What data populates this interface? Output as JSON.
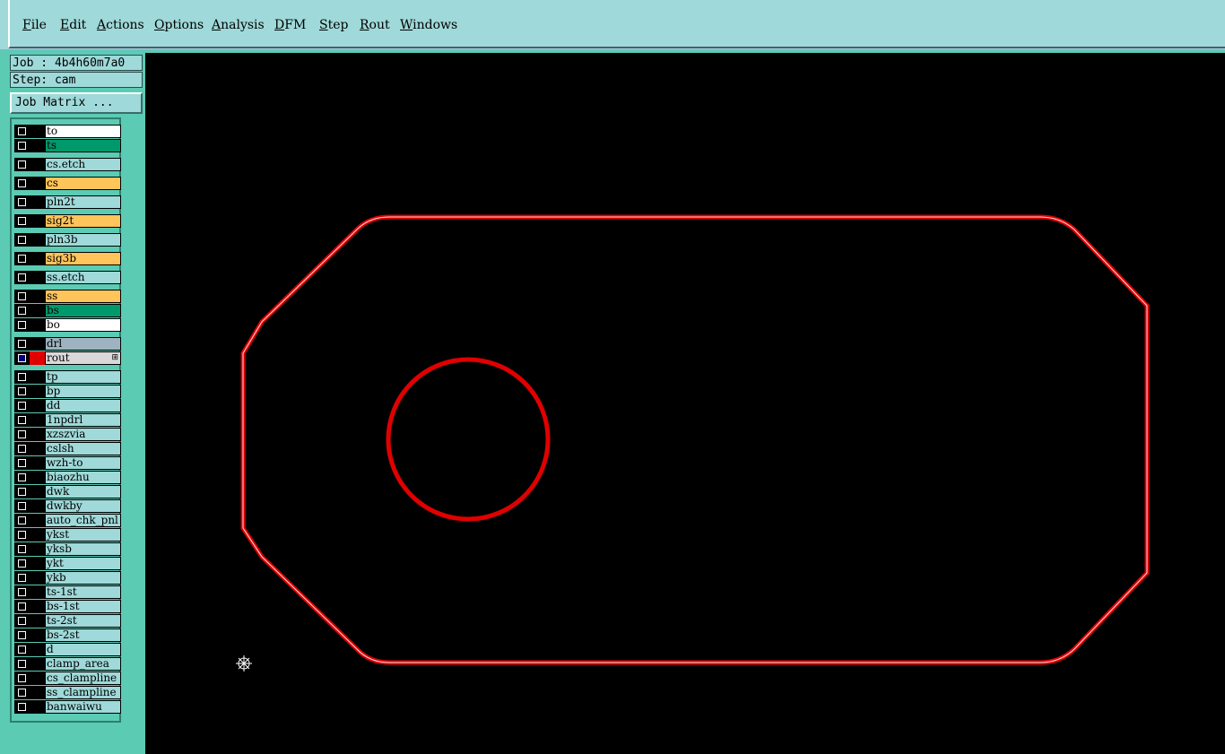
{
  "menu": [
    {
      "label": "File"
    },
    {
      "label": "Edit"
    },
    {
      "label": "Actions"
    },
    {
      "label": "Options"
    },
    {
      "label": "Analysis"
    },
    {
      "label": "DFM"
    },
    {
      "label": "Step"
    },
    {
      "label": "Rout"
    },
    {
      "label": "Windows"
    }
  ],
  "info": {
    "job": "Job : 4b4h60m7a0",
    "step": "Step: cam",
    "job_matrix_button": "Job Matrix ..."
  },
  "layers": [
    {
      "name": "to",
      "color": "white"
    },
    {
      "name": "ts",
      "color": "green"
    },
    {
      "name": "cs.etch",
      "color": "cyan"
    },
    {
      "name": "cs",
      "color": "orange"
    },
    {
      "name": "pln2t",
      "color": "cyan"
    },
    {
      "name": "sig2t",
      "color": "orange"
    },
    {
      "name": "pln3b",
      "color": "cyan"
    },
    {
      "name": "sig3b",
      "color": "orange"
    },
    {
      "name": "ss.etch",
      "color": "cyan"
    },
    {
      "name": "ss",
      "color": "orange"
    },
    {
      "name": "bs",
      "color": "green"
    },
    {
      "name": "bo",
      "color": "white"
    },
    {
      "name": "drl",
      "color": "gray"
    },
    {
      "name": "rout",
      "color": "lgray",
      "active": true
    },
    {
      "name": "tp",
      "color": "cyan"
    },
    {
      "name": "bp",
      "color": "cyan"
    },
    {
      "name": "dd",
      "color": "cyan"
    },
    {
      "name": "1npdrl",
      "color": "cyan"
    },
    {
      "name": "xzszvia",
      "color": "cyan"
    },
    {
      "name": "cslsh",
      "color": "cyan"
    },
    {
      "name": "wzh-to",
      "color": "cyan"
    },
    {
      "name": "biaozhu",
      "color": "cyan"
    },
    {
      "name": "dwk",
      "color": "cyan"
    },
    {
      "name": "dwkby",
      "color": "cyan"
    },
    {
      "name": "auto_chk_pnl",
      "color": "cyan"
    },
    {
      "name": "ykst",
      "color": "cyan"
    },
    {
      "name": "yksb",
      "color": "cyan"
    },
    {
      "name": "ykt",
      "color": "cyan"
    },
    {
      "name": "ykb",
      "color": "cyan"
    },
    {
      "name": "ts-1st",
      "color": "cyan"
    },
    {
      "name": "bs-1st",
      "color": "cyan"
    },
    {
      "name": "ts-2st",
      "color": "cyan"
    },
    {
      "name": "bs-2st",
      "color": "cyan"
    },
    {
      "name": "d",
      "color": "cyan"
    },
    {
      "name": "clamp_area",
      "color": "cyan"
    },
    {
      "name": "cs_clampline",
      "color": "cyan"
    },
    {
      "name": "ss_clampline",
      "color": "cyan"
    },
    {
      "name": "banwaiwu",
      "color": "cyan"
    }
  ],
  "colors": {
    "rout_outline": "#e00000",
    "canvas_bg": "#000000",
    "active_layer_checkbox": "#000080",
    "active_layer_color": "#e00000"
  },
  "icons": {
    "cursor": "crosshair-star-icon"
  }
}
